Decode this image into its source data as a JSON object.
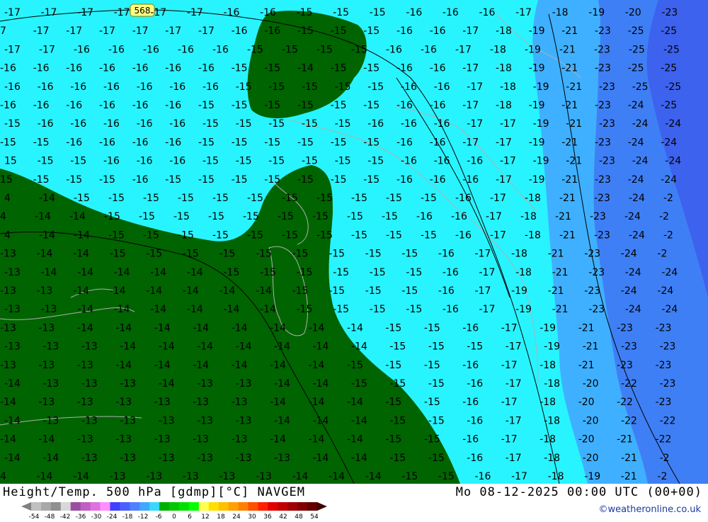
{
  "map": {
    "contour_label": "568",
    "rows": [
      {
        "values": [
          "-17",
          "-17",
          "-17",
          "-17",
          "-17",
          "-17",
          "-16",
          "-16",
          "-15",
          "-15",
          "-15",
          "-16",
          "-16",
          "-16",
          "-17",
          "-18",
          "-19",
          "-20",
          "-23"
        ]
      },
      {
        "values": [
          "7",
          "-17",
          "-17",
          "-17",
          "-17",
          "-17",
          "-17",
          "-16",
          "-16",
          "-15",
          "-15",
          "-15",
          "-16",
          "-16",
          "-17",
          "-18",
          "-19",
          "-21",
          "-23",
          "-25",
          "-25"
        ]
      },
      {
        "values": [
          "-17",
          "-17",
          "-16",
          "-16",
          "-16",
          "-16",
          "-16",
          "-15",
          "-15",
          "-15",
          "-15",
          "-16",
          "-16",
          "-17",
          "-18",
          "-19",
          "-21",
          "-23",
          "-25",
          "-25"
        ]
      },
      {
        "values": [
          "-16",
          "-16",
          "-16",
          "-16",
          "-16",
          "-16",
          "-16",
          "-15",
          "-15",
          "-14",
          "-15",
          "-15",
          "-16",
          "-16",
          "-17",
          "-18",
          "-19",
          "-21",
          "-23",
          "-25",
          "-25"
        ]
      },
      {
        "values": [
          "-16",
          "-16",
          "-16",
          "-16",
          "-16",
          "-16",
          "-16",
          "-15",
          "-15",
          "-15",
          "-15",
          "-15",
          "-16",
          "-16",
          "-17",
          "-18",
          "-19",
          "-21",
          "-23",
          "-25",
          "-25"
        ]
      },
      {
        "values": [
          "-16",
          "-16",
          "-16",
          "-16",
          "-16",
          "-16",
          "-15",
          "-15",
          "-15",
          "-15",
          "-15",
          "-15",
          "-16",
          "-16",
          "-17",
          "-18",
          "-19",
          "-21",
          "-23",
          "-24",
          "-25"
        ]
      },
      {
        "values": [
          "-15",
          "-16",
          "-16",
          "-16",
          "-16",
          "-16",
          "-15",
          "-15",
          "-15",
          "-15",
          "-15",
          "-16",
          "-16",
          "-16",
          "-17",
          "-17",
          "-19",
          "-21",
          "-23",
          "-24",
          "-24"
        ]
      },
      {
        "values": [
          "-15",
          "-15",
          "-16",
          "-16",
          "-16",
          "-16",
          "-15",
          "-15",
          "-15",
          "-15",
          "-15",
          "-15",
          "-16",
          "-16",
          "-17",
          "-17",
          "-19",
          "-21",
          "-23",
          "-24",
          "-24"
        ]
      },
      {
        "values": [
          "15",
          "-15",
          "-15",
          "-16",
          "-16",
          "-16",
          "-15",
          "-15",
          "-15",
          "-15",
          "-15",
          "-15",
          "-16",
          "-16",
          "-16",
          "-17",
          "-19",
          "-21",
          "-23",
          "-24",
          "-24"
        ]
      },
      {
        "values": [
          "15",
          "-15",
          "-15",
          "-15",
          "-16",
          "-15",
          "-15",
          "-15",
          "-15",
          "-15",
          "-15",
          "-15",
          "-16",
          "-16",
          "-16",
          "-17",
          "-19",
          "-21",
          "-23",
          "-24",
          "-24"
        ]
      },
      {
        "values": [
          "4",
          "-14",
          "-15",
          "-15",
          "-15",
          "-15",
          "-15",
          "-15",
          "-15",
          "-15",
          "-15",
          "-15",
          "-15",
          "-16",
          "-17",
          "-18",
          "-21",
          "-23",
          "-24",
          "-2"
        ]
      },
      {
        "values": [
          "4",
          "-14",
          "-14",
          "-15",
          "-15",
          "-15",
          "-15",
          "-15",
          "-15",
          "-15",
          "-15",
          "-15",
          "-16",
          "-16",
          "-17",
          "-18",
          "-21",
          "-23",
          "-24",
          "-2"
        ]
      },
      {
        "values": [
          "4",
          "-14",
          "-14",
          "-15",
          "-15",
          "-15",
          "-15",
          "-15",
          "-15",
          "-15",
          "-15",
          "-15",
          "-15",
          "-16",
          "-17",
          "-18",
          "-21",
          "-23",
          "-24",
          "-2"
        ]
      },
      {
        "values": [
          "-13",
          "-14",
          "-14",
          "-15",
          "-15",
          "-15",
          "-15",
          "-15",
          "-15",
          "-15",
          "-15",
          "-15",
          "-16",
          "-17",
          "-18",
          "-21",
          "-23",
          "-24",
          "-2"
        ]
      },
      {
        "values": [
          "-13",
          "-14",
          "-14",
          "-14",
          "-14",
          "-14",
          "-15",
          "-15",
          "-15",
          "-15",
          "-15",
          "-15",
          "-16",
          "-17",
          "-18",
          "-21",
          "-23",
          "-24",
          "-24"
        ]
      },
      {
        "values": [
          "-13",
          "-13",
          "-14",
          "-14",
          "-14",
          "-14",
          "-14",
          "-14",
          "-15",
          "-15",
          "-15",
          "-15",
          "-16",
          "-17",
          "-19",
          "-21",
          "-23",
          "-24",
          "-24"
        ]
      },
      {
        "values": [
          "-13",
          "-13",
          "-14",
          "-14",
          "-14",
          "-14",
          "-14",
          "-14",
          "-15",
          "-15",
          "-15",
          "-15",
          "-16",
          "-17",
          "-19",
          "-21",
          "-23",
          "-24",
          "-24"
        ]
      },
      {
        "values": [
          "-13",
          "-13",
          "-14",
          "-14",
          "-14",
          "-14",
          "-14",
          "-14",
          "-14",
          "-14",
          "-15",
          "-15",
          "-16",
          "-17",
          "-19",
          "-21",
          "-23",
          "-23"
        ]
      },
      {
        "values": [
          "-13",
          "-13",
          "-13",
          "-14",
          "-14",
          "-14",
          "-14",
          "-14",
          "-14",
          "-14",
          "-15",
          "-15",
          "-15",
          "-17",
          "-19",
          "-21",
          "-23",
          "-23"
        ]
      },
      {
        "values": [
          "-13",
          "-13",
          "-13",
          "-14",
          "-14",
          "-14",
          "-14",
          "-14",
          "-14",
          "-15",
          "-15",
          "-15",
          "-16",
          "-17",
          "-18",
          "-21",
          "-23",
          "-23"
        ]
      },
      {
        "values": [
          "-14",
          "-13",
          "-13",
          "-13",
          "-14",
          "-13",
          "-13",
          "-14",
          "-14",
          "-15",
          "-15",
          "-15",
          "-16",
          "-17",
          "-18",
          "-20",
          "-22",
          "-23"
        ]
      },
      {
        "values": [
          "-14",
          "-13",
          "-13",
          "-13",
          "-13",
          "-13",
          "-13",
          "-14",
          "-14",
          "-14",
          "-15",
          "-15",
          "-16",
          "-17",
          "-18",
          "-20",
          "-22",
          "-23"
        ]
      },
      {
        "values": [
          "-14",
          "-13",
          "-13",
          "-13",
          "-13",
          "-13",
          "-13",
          "-14",
          "-14",
          "-14",
          "-15",
          "-15",
          "-16",
          "-17",
          "-18",
          "-20",
          "-22",
          "-22"
        ]
      },
      {
        "values": [
          "-14",
          "-14",
          "-13",
          "-13",
          "-13",
          "-13",
          "-13",
          "-14",
          "-14",
          "-14",
          "-15",
          "-15",
          "-16",
          "-17",
          "-18",
          "-20",
          "-21",
          "-22"
        ]
      },
      {
        "values": [
          "-14",
          "-14",
          "-13",
          "-13",
          "-13",
          "-13",
          "-13",
          "-13",
          "-14",
          "-14",
          "-15",
          "-15",
          "-16",
          "-17",
          "-18",
          "-20",
          "-21",
          "-2"
        ]
      },
      {
        "values": [
          "4",
          "-14",
          "-14",
          "-13",
          "-13",
          "-13",
          "-13",
          "-13",
          "-14",
          "-14",
          "-14",
          "-15",
          "-15",
          "-16",
          "-17",
          "-18",
          "-19",
          "-21",
          "-2"
        ]
      }
    ]
  },
  "footer": {
    "title_left": "Height/Temp. 500 hPa [gdmp][°C] NAVGEM",
    "title_right": "Mo 08-12-2025 00:00 UTC (00+00)",
    "credit": "©weatheronline.co.uk",
    "legend_ticks": [
      "-54",
      "-48",
      "-42",
      "-36",
      "-30",
      "-24",
      "-18",
      "-12",
      "-6",
      "0",
      "6",
      "12",
      "18",
      "24",
      "30",
      "36",
      "42",
      "48",
      "54"
    ],
    "legend_colors": [
      "#c0c0c0",
      "#a8a8a8",
      "#909090",
      "#d8d8d8",
      "#9a4ea0",
      "#c060c0",
      "#e070e0",
      "#ff90ff",
      "#4040ff",
      "#4860ff",
      "#5080ff",
      "#40a8ff",
      "#38d8ff",
      "#00b000",
      "#00c800",
      "#00e000",
      "#00ff00",
      "#ffff50",
      "#ffe000",
      "#ffc000",
      "#ffa000",
      "#ff8000",
      "#ff5000",
      "#ff2000",
      "#e00000",
      "#c00000",
      "#a00000",
      "#800000",
      "#600000"
    ]
  },
  "colors": {
    "light_cyan": "#28f4ff",
    "mid_blue": "#3fb0ff",
    "deep_blue": "#3f7ff5",
    "darker_blue": "#3d62ee",
    "green": "#006400"
  }
}
